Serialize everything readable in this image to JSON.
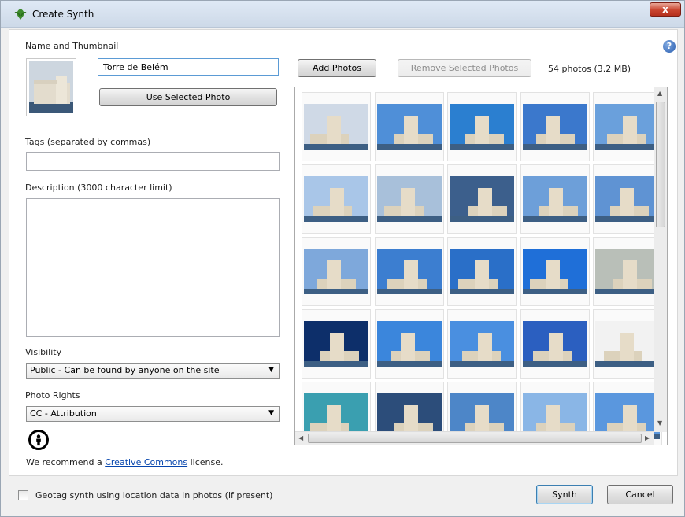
{
  "window": {
    "title": "Create Synth",
    "close_label": "x"
  },
  "left": {
    "name_thumbnail_label": "Name and Thumbnail",
    "name_value": "Torre de Belém",
    "use_selected_photo_label": "Use Selected Photo",
    "tags_label": "Tags (separated by commas)",
    "tags_value": "",
    "description_label": "Description (3000 character limit)",
    "description_value": "",
    "visibility_label": "Visibility",
    "visibility_value": "Public - Can be found by anyone on the site",
    "photo_rights_label": "Photo Rights",
    "photo_rights_value": "CC - Attribution",
    "recommend_prefix": "We recommend a ",
    "recommend_link": "Creative Commons",
    "recommend_suffix": " license."
  },
  "right": {
    "add_photos_label": "Add Photos",
    "remove_photos_label": "Remove Selected Photos",
    "photo_count": "54 photos (3.2 MB)",
    "help_label": "?"
  },
  "footer": {
    "geotag_label": "Geotag synth using location data in photos (if present)",
    "synth_label": "Synth",
    "cancel_label": "Cancel"
  },
  "icons": {
    "app": "leaf-icon",
    "help": "help-icon",
    "license": "cc-attribution-icon"
  },
  "photos": [
    {
      "sky": "#cfd9e6"
    },
    {
      "sky": "#4f8fd8"
    },
    {
      "sky": "#2b7fd0"
    },
    {
      "sky": "#3b78cc"
    },
    {
      "sky": "#6aa0dc"
    },
    {
      "sky": "#a9c6e8"
    },
    {
      "sky": "#a8c0da"
    },
    {
      "sky": "#3c5f8c"
    },
    {
      "sky": "#6d9fd9"
    },
    {
      "sky": "#5f93d3"
    },
    {
      "sky": "#7ea8db"
    },
    {
      "sky": "#3c7ed0"
    },
    {
      "sky": "#2a6fc8"
    },
    {
      "sky": "#1f6fd8"
    },
    {
      "sky": "#b9bfb8"
    },
    {
      "sky": "#0d2f6a"
    },
    {
      "sky": "#3b86dc"
    },
    {
      "sky": "#4a8fe0"
    },
    {
      "sky": "#2b5fc0"
    },
    {
      "sky": "#f2f2f2"
    },
    {
      "sky": "#3a9fb0"
    },
    {
      "sky": "#2c4d7a"
    },
    {
      "sky": "#4d86c8"
    },
    {
      "sky": "#8ab6e6"
    },
    {
      "sky": "#5a97de"
    }
  ]
}
